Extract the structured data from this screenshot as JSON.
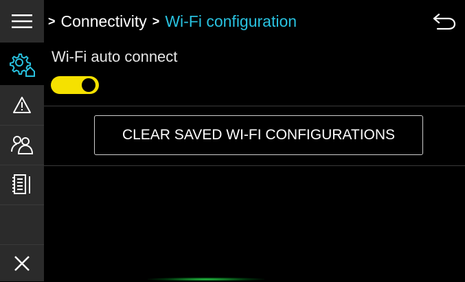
{
  "breadcrumb": {
    "separator": ">",
    "items": [
      "Connectivity",
      "Wi-Fi configuration"
    ]
  },
  "settings": {
    "wifi_auto_connect": {
      "label": "Wi-Fi auto connect",
      "enabled": true
    },
    "clear_button_label": "CLEAR SAVED WI-FI CONFIGURATIONS"
  },
  "sidebar": {
    "items": [
      {
        "icon": "menu-icon"
      },
      {
        "icon": "settings-home-icon",
        "active": true
      },
      {
        "icon": "warning-icon"
      },
      {
        "icon": "users-icon"
      },
      {
        "icon": "notebook-icon"
      },
      {
        "icon": "close-icon"
      }
    ]
  },
  "colors": {
    "accent_cyan": "#29c2e0",
    "toggle_yellow": "#f5e100",
    "sidebar_bg": "#2b2b2b"
  }
}
